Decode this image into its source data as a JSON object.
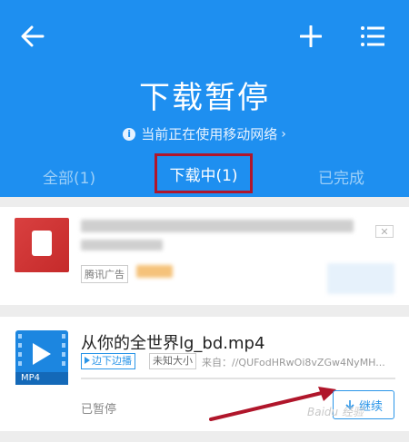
{
  "header": {
    "title": "下载暂停",
    "network_notice": "当前正在使用移动网络"
  },
  "tabs": [
    {
      "label": "全部(1)"
    },
    {
      "label": "下载中(1)"
    },
    {
      "label": "已完成"
    }
  ],
  "ad": {
    "badge": "腾讯广告"
  },
  "download": {
    "filename": "从你的全世界lg_bd.mp4",
    "file_ext": "MP4",
    "tag_stream": "边下边播",
    "tag_size": "未知大小",
    "source": "来自：//QUFodHRwOi8vZGw4NyMH...",
    "status": "已暂停",
    "progress": 0.0,
    "resume_label": "继续"
  },
  "colors": {
    "header_bg": "#1e8ff0",
    "accent": "#2a95e8",
    "highlight": "#b0162b"
  },
  "watermark": "Baidu 经验"
}
